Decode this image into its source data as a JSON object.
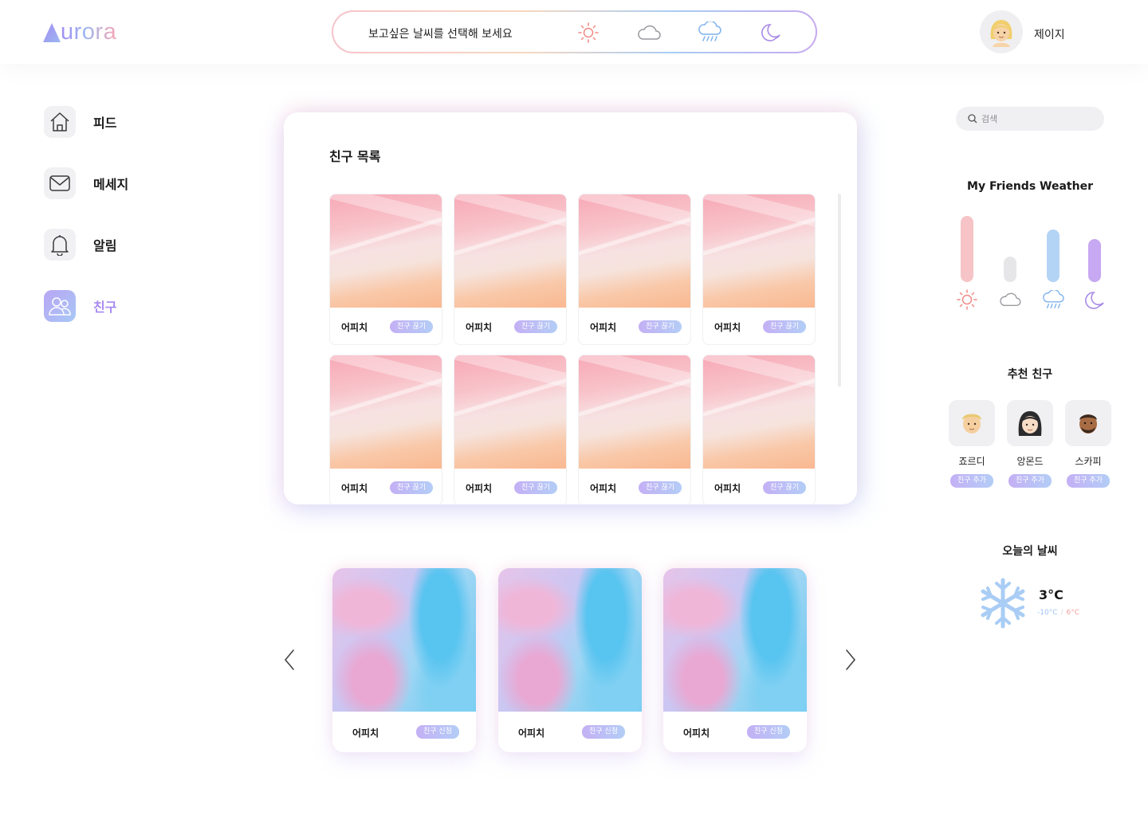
{
  "app": {
    "logo_text": "urora",
    "logo_letter": "A",
    "weather_prompt": "보고싶은 날씨를 선택해 보세요",
    "weather_options": [
      "sun-icon",
      "cloud-icon",
      "rain-icon",
      "moon-icon"
    ],
    "user_name": "제이지"
  },
  "sidebar": {
    "items": [
      {
        "label": "피드",
        "icon": "home-icon",
        "active": false
      },
      {
        "label": "메세지",
        "icon": "mail-icon",
        "active": false
      },
      {
        "label": "알림",
        "icon": "bell-icon",
        "active": false
      },
      {
        "label": "친구",
        "icon": "friends-icon",
        "active": true
      }
    ]
  },
  "friends": {
    "title": "친구 목록",
    "cards": [
      {
        "name": "어피치",
        "action": "친구 끊기"
      },
      {
        "name": "어피치",
        "action": "친구 끊기"
      },
      {
        "name": "어피치",
        "action": "친구 끊기"
      },
      {
        "name": "어피치",
        "action": "친구 끊기"
      },
      {
        "name": "어피치",
        "action": "친구 끊기"
      },
      {
        "name": "어피치",
        "action": "친구 끊기"
      },
      {
        "name": "어피치",
        "action": "친구 끊기"
      },
      {
        "name": "어피치",
        "action": "친구 끊기"
      }
    ]
  },
  "carousel": {
    "cards": [
      {
        "name": "어피치",
        "action": "친구 신청"
      },
      {
        "name": "어피치",
        "action": "친구 신청"
      },
      {
        "name": "어피치",
        "action": "친구 신청"
      }
    ]
  },
  "search": {
    "placeholder": "검색"
  },
  "friends_weather": {
    "title": "My Friends Weather",
    "bars": [
      {
        "weather": "sun-icon",
        "level": 1.0,
        "color": "#f6c4c6"
      },
      {
        "weather": "cloud-icon",
        "level": 0.38,
        "color": "#e6e6e8"
      },
      {
        "weather": "rain-icon",
        "level": 0.8,
        "color": "#b4d4f6"
      },
      {
        "weather": "moon-icon",
        "level": 0.65,
        "color": "#c7a8f2"
      }
    ]
  },
  "recommended": {
    "title": "추천 친구",
    "friends": [
      {
        "name": "죠르디",
        "action": "친구 추가"
      },
      {
        "name": "앙몬드",
        "action": "친구 추가"
      },
      {
        "name": "스카피",
        "action": "친구 추가"
      }
    ]
  },
  "today_weather": {
    "title": "오늘의 날씨",
    "icon": "snowflake-icon",
    "temp": "3°C",
    "min": "-10°C",
    "sep": "/",
    "max": "6°C"
  },
  "colors": {
    "accent_purple": "#a889ef",
    "accent_blue": "#a8c8f6",
    "accent_pink": "#f6a6b6"
  }
}
